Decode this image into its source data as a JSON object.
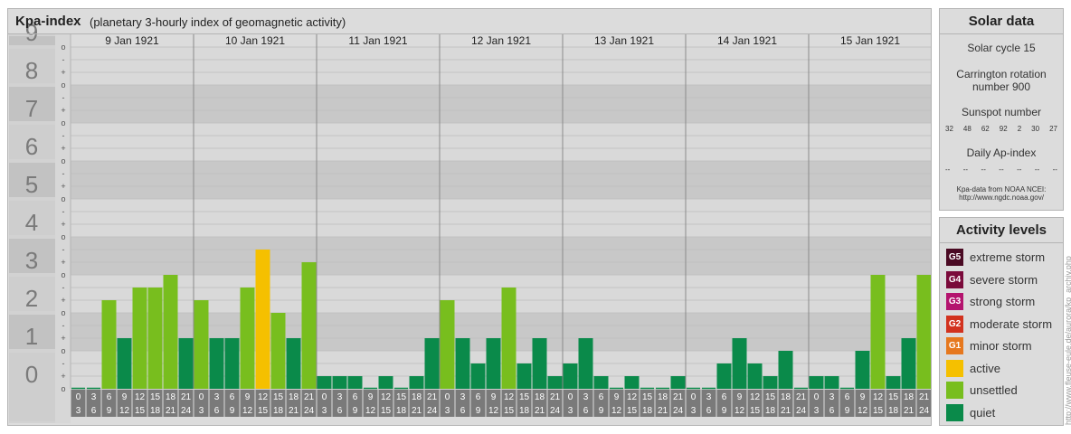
{
  "header": {
    "title": "Kpa-index",
    "subtitle": "(planetary 3-hourly index of geomagnetic activity)"
  },
  "chart_data": {
    "type": "bar",
    "title": "Kpa-index",
    "subtitle": "(planetary 3-hourly index of geomagnetic activity)",
    "y_ticks": [
      "0",
      "1",
      "2",
      "3",
      "4",
      "5",
      "6",
      "7",
      "8",
      "9"
    ],
    "y_subticks": [
      "o",
      "+",
      "-"
    ],
    "ylim": [
      0,
      9
    ],
    "days": [
      "9 Jan 1921",
      "10 Jan 1921",
      "11 Jan 1921",
      "12 Jan 1921",
      "13 Jan 1921",
      "14 Jan 1921",
      "15 Jan 1921"
    ],
    "interval_start_labels": [
      "0",
      "3",
      "6",
      "9",
      "12",
      "15",
      "18",
      "21"
    ],
    "interval_end_labels": [
      "3",
      "6",
      "9",
      "12",
      "15",
      "18",
      "21",
      "24"
    ],
    "values": [
      [
        0,
        0,
        2.333,
        1.333,
        2.667,
        2.667,
        3,
        1.333
      ],
      [
        2.333,
        1.333,
        1.333,
        2.667,
        3.667,
        2,
        1.333,
        3.333
      ],
      [
        0.333,
        0.333,
        0.333,
        0,
        0.333,
        0,
        0.333,
        1.333
      ],
      [
        2.333,
        1.333,
        0.667,
        1.333,
        2.667,
        0.667,
        1.333,
        0.333
      ],
      [
        0.667,
        1.333,
        0.333,
        0,
        0.333,
        0,
        0,
        0.333
      ],
      [
        0,
        0,
        0.667,
        1.333,
        0.667,
        0.333,
        1,
        0
      ],
      [
        0.333,
        0.333,
        0,
        1,
        3,
        0.333,
        1.333,
        3
      ]
    ],
    "color_scale": [
      {
        "level": "quiet",
        "color": "#0a8a4a"
      },
      {
        "level": "unsettled",
        "color": "#78be1e"
      },
      {
        "level": "active",
        "color": "#f5c000"
      }
    ],
    "grid": true
  },
  "solar": {
    "heading": "Solar data",
    "cycle": "Solar cycle 15",
    "carrington_line1": "Carrington rotation",
    "carrington_line2": "number 900",
    "sunspot_label": "Sunspot number",
    "sunspots": [
      "32",
      "48",
      "62",
      "92",
      "2",
      "30",
      "27"
    ],
    "ap_label": "Daily Ap-index",
    "ap_values": [
      "--",
      "--",
      "--",
      "--",
      "--",
      "--",
      "--"
    ],
    "source_line1": "Kpa-data from NOAA NCEI:",
    "source_line2": "http://www.ngdc.noaa.gov/"
  },
  "activity": {
    "heading": "Activity levels",
    "levels": [
      {
        "code": "G5",
        "label": "extreme storm",
        "color": "#4a0a23"
      },
      {
        "code": "G4",
        "label": "severe storm",
        "color": "#7a0a3a"
      },
      {
        "code": "G3",
        "label": "strong storm",
        "color": "#b4146e"
      },
      {
        "code": "G2",
        "label": "moderate storm",
        "color": "#d2321e"
      },
      {
        "code": "G1",
        "label": "minor storm",
        "color": "#e6781e"
      },
      {
        "code": "",
        "label": "active",
        "color": "#f5c000"
      },
      {
        "code": "",
        "label": "unsettled",
        "color": "#78be1e"
      },
      {
        "code": "",
        "label": "quiet",
        "color": "#0a8a4a"
      }
    ]
  },
  "footer": {
    "site": "http://www.fleuse-eule.de/aurora/kp_archiv.php"
  }
}
